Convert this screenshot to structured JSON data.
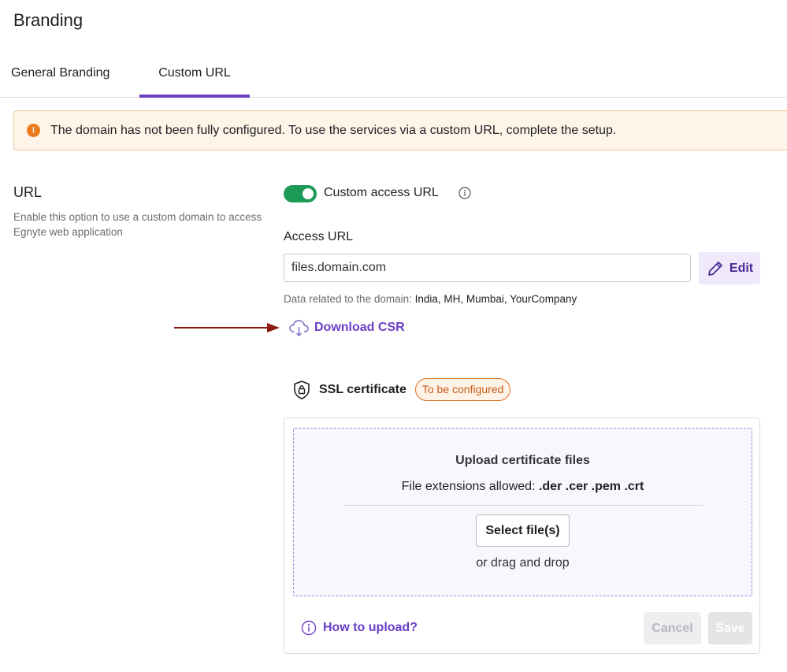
{
  "page": {
    "title": "Branding"
  },
  "tabs": [
    {
      "label": "General Branding",
      "active": false
    },
    {
      "label": "Custom URL",
      "active": true
    }
  ],
  "alert": {
    "icon": "warning-circle-icon",
    "text": "The domain has not been fully configured. To use the services via a custom URL, complete the setup."
  },
  "url_section": {
    "title": "URL",
    "description": "Enable this option to use a custom domain to access Egnyte web application",
    "toggle": {
      "label": "Custom access URL",
      "on": true
    },
    "access_url": {
      "label": "Access URL",
      "value": "files.domain.com",
      "edit_label": "Edit"
    },
    "domain_data": {
      "prefix": "Data related to the domain: ",
      "value": "India, MH, Mumbai, YourCompany"
    },
    "download_label": "Download CSR"
  },
  "ssl": {
    "title": "SSL certificate",
    "status": "To be configured",
    "upload": {
      "title": "Upload certificate files",
      "ext_prefix": "File extensions allowed: ",
      "extensions": ".der .cer .pem .crt",
      "select_label": "Select file(s)",
      "drag_text": "or drag and drop"
    },
    "how_to_label": "How to upload?",
    "cancel_label": "Cancel",
    "save_label": "Save"
  },
  "colors": {
    "accent": "#6b3fc4",
    "toggle_on": "#1d9a55",
    "warning": "#ec7b1d",
    "annotation_arrow": "#8b1a10"
  }
}
